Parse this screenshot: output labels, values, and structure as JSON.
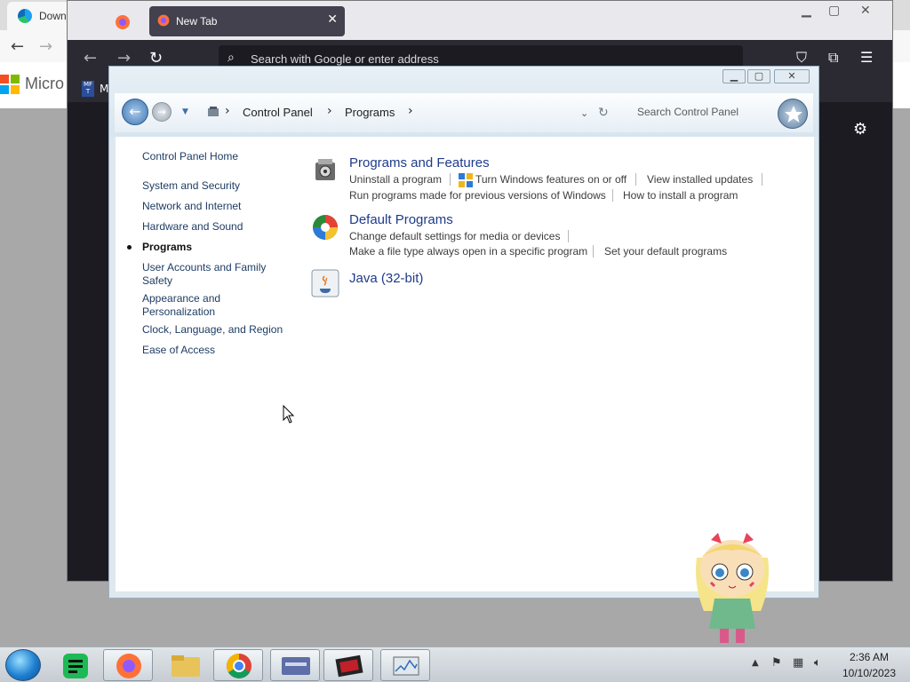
{
  "edge": {
    "tab_title": "Down",
    "page_brand": "Micro"
  },
  "firefox": {
    "active_tab_title": "New Tab",
    "active_tab_close": "✕",
    "url_placeholder": "Search with Google or enter address",
    "bookmark_label": "M",
    "bookmark_icon_text": "MF\nT"
  },
  "control_panel": {
    "breadcrumbs": [
      "Control Panel",
      "Programs"
    ],
    "search_placeholder": "Search Control Panel",
    "nav": [
      {
        "label": "Control Panel Home",
        "current": false
      },
      {
        "label": "System and Security",
        "current": false
      },
      {
        "label": "Network and Internet",
        "current": false
      },
      {
        "label": "Hardware and Sound",
        "current": false
      },
      {
        "label": "Programs",
        "current": true
      },
      {
        "label": "User Accounts and Family Safety",
        "current": false
      },
      {
        "label": "Appearance and Personalization",
        "current": false
      },
      {
        "label": "Clock, Language, and Region",
        "current": false
      },
      {
        "label": "Ease of Access",
        "current": false
      }
    ],
    "categories": [
      {
        "title": "Programs and Features",
        "icon": "programs-features-icon",
        "tasks": [
          "Uninstall a program",
          "Turn Windows features on or off",
          "View installed updates",
          "Run programs made for previous versions of Windows",
          "How to install a program"
        ]
      },
      {
        "title": "Default Programs",
        "icon": "default-programs-icon",
        "tasks": [
          "Change default settings for media or devices",
          "Make a file type always open in a specific program",
          "Set your default programs"
        ]
      },
      {
        "title": "Java (32-bit)",
        "icon": "java-icon",
        "tasks": []
      }
    ]
  },
  "taskbar": {
    "apps": [
      "spotify-icon",
      "firefox-icon",
      "file-explorer-icon",
      "chrome-icon",
      "control-panel-icon",
      "media-player-icon",
      "system-monitor-icon"
    ],
    "time": "2:36 AM",
    "date": "10/10/2023"
  },
  "colors": {
    "link_blue": "#1e3b8c",
    "nav_blue": "#1e3c64",
    "firefox_dark": "#1c1b22"
  }
}
